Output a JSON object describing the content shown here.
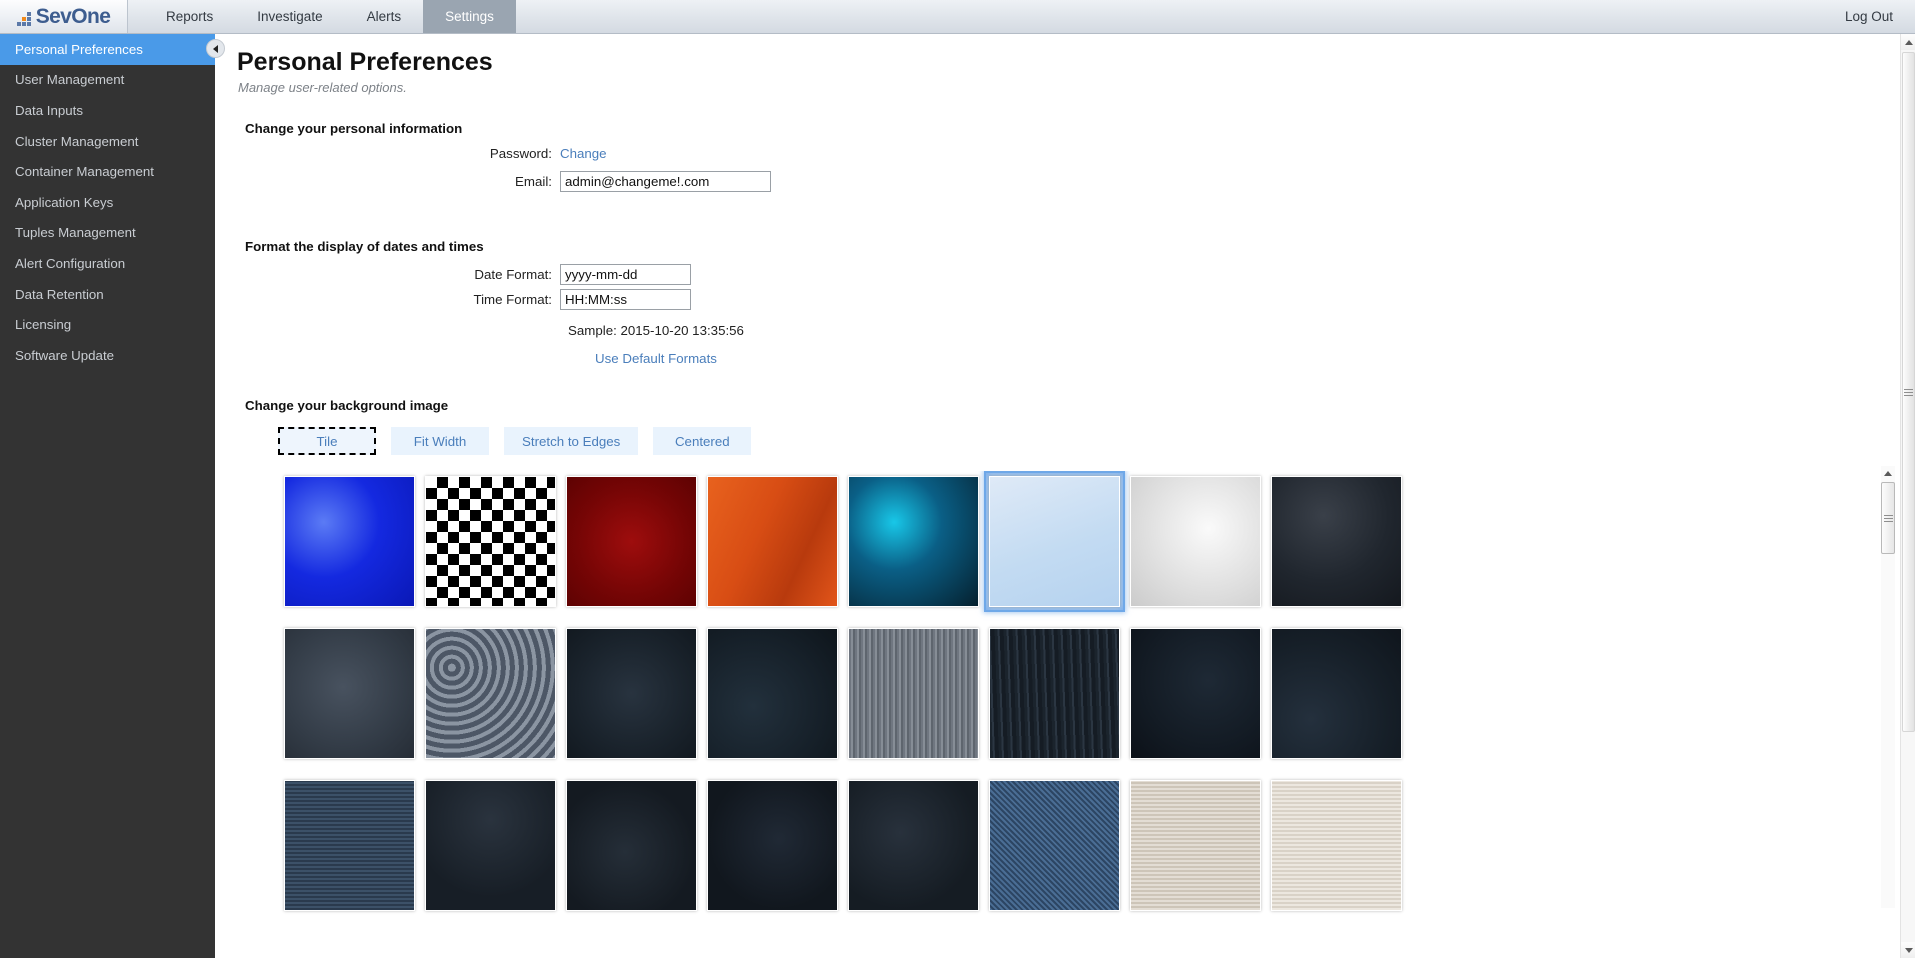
{
  "topbar": {
    "logo_text": "SevOne",
    "logo_icon": "bar-chart-logo-icon",
    "nav": [
      {
        "label": "Reports",
        "active": false
      },
      {
        "label": "Investigate",
        "active": false
      },
      {
        "label": "Alerts",
        "active": false
      },
      {
        "label": "Settings",
        "active": true
      }
    ],
    "logout_label": "Log Out"
  },
  "sidebar": {
    "collapse_icon": "chevron-left-icon",
    "items": [
      {
        "label": "Personal Preferences",
        "active": true
      },
      {
        "label": "User Management",
        "active": false
      },
      {
        "label": "Data Inputs",
        "active": false
      },
      {
        "label": "Cluster Management",
        "active": false
      },
      {
        "label": "Container Management",
        "active": false
      },
      {
        "label": "Application Keys",
        "active": false
      },
      {
        "label": "Tuples Management",
        "active": false
      },
      {
        "label": "Alert Configuration",
        "active": false
      },
      {
        "label": "Data Retention",
        "active": false
      },
      {
        "label": "Licensing",
        "active": false
      },
      {
        "label": "Software Update",
        "active": false
      }
    ]
  },
  "page": {
    "title": "Personal Preferences",
    "subtitle": "Manage user-related options."
  },
  "personal_info": {
    "heading": "Change your personal information",
    "password_label": "Password:",
    "password_change_link": "Change",
    "email_label": "Email:",
    "email_value": "admin@changeme!.com"
  },
  "datetime": {
    "heading": "Format the display of dates and times",
    "date_label": "Date Format:",
    "date_value": "yyyy-mm-dd",
    "time_label": "Time Format:",
    "time_value": "HH:MM:ss",
    "sample": "Sample: 2015-10-20 13:35:56",
    "defaults_link": "Use Default Formats"
  },
  "background": {
    "heading": "Change your background image",
    "modes": [
      {
        "label": "Tile",
        "focused": true
      },
      {
        "label": "Fit Width",
        "focused": false
      },
      {
        "label": "Stretch to Edges",
        "focused": false
      },
      {
        "label": "Centered",
        "focused": false
      }
    ],
    "selected_thumbnail_index": 5,
    "thumbnails": [
      {
        "name": "blue-abstract",
        "selected": false
      },
      {
        "name": "black-white-checkerboard",
        "selected": false
      },
      {
        "name": "dark-red-gradient",
        "selected": false
      },
      {
        "name": "orange-abstract",
        "selected": false
      },
      {
        "name": "sevone-cyan-logo-art",
        "selected": false
      },
      {
        "name": "light-blue-city-skyline",
        "selected": true
      },
      {
        "name": "light-grey-abstract",
        "selected": false
      },
      {
        "name": "dark-charcoal-grunge",
        "selected": false
      },
      {
        "name": "slate-spiral-pattern",
        "selected": false
      },
      {
        "name": "grey-circles-pattern",
        "selected": false
      },
      {
        "name": "navy-grunge-texture",
        "selected": false
      },
      {
        "name": "dark-navy-texture",
        "selected": false
      },
      {
        "name": "grey-brushed-metal",
        "selected": false
      },
      {
        "name": "dark-scratched-texture",
        "selected": false
      },
      {
        "name": "deep-navy-texture",
        "selected": false
      },
      {
        "name": "dark-blue-mottled",
        "selected": false
      },
      {
        "name": "blue-grain-strip",
        "selected": false
      },
      {
        "name": "dark-strip-two",
        "selected": false
      },
      {
        "name": "dark-strip-three",
        "selected": false
      },
      {
        "name": "dark-strip-four",
        "selected": false
      },
      {
        "name": "dark-strip-five",
        "selected": false
      },
      {
        "name": "blue-noise-strip",
        "selected": false
      },
      {
        "name": "light-grain-strip",
        "selected": false
      },
      {
        "name": "pale-strip",
        "selected": false
      }
    ]
  },
  "scrollbars": {
    "page_scroll_up_icon": "triangle-up-icon",
    "page_scroll_down_icon": "triangle-down-icon",
    "thumbnail_scroll_up_icon": "triangle-up-icon"
  },
  "colors": {
    "accent_blue": "#4a9ae8",
    "sidebar_bg": "#333333",
    "link_blue": "#4a7ebb",
    "logo_blue": "#3d5d8f",
    "logo_orange": "#f08a1c"
  }
}
